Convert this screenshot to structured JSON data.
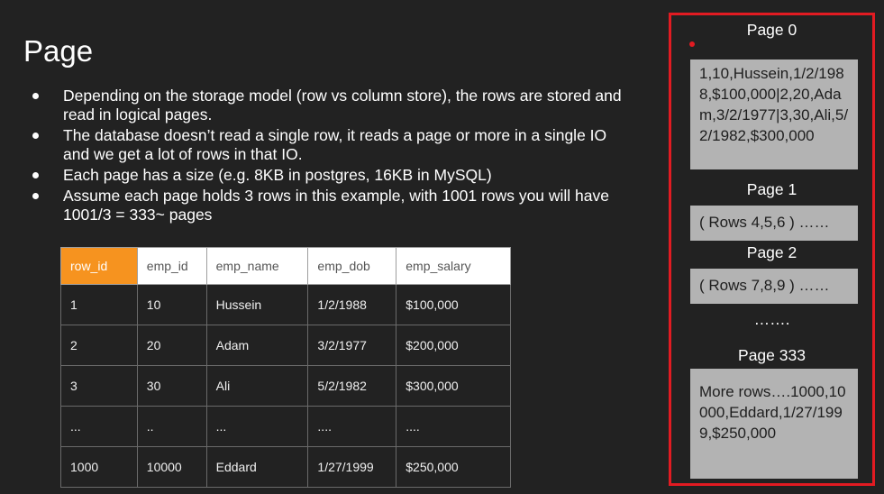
{
  "slide": {
    "title": "Page",
    "bullets": [
      "Depending on the storage model (row vs column store), the rows are stored and read in logical pages.",
      "The database doesn’t read a single row, it reads a page or more in a single IO and we get a lot of rows in that IO.",
      "Each page has a size (e.g. 8KB in postgres, 16KB in MySQL)",
      "Assume each page holds 3 rows in this example, with 1001 rows you will have 1001/3 = 333~ pages"
    ]
  },
  "table": {
    "headers": [
      "row_id",
      "emp_id",
      "emp_name",
      "emp_dob",
      "emp_salary"
    ],
    "rows": [
      [
        "1",
        "10",
        "Hussein",
        "1/2/1988",
        "$100,000"
      ],
      [
        "2",
        "20",
        "Adam",
        "3/2/1977",
        "$200,000"
      ],
      [
        "3",
        "30",
        "Ali",
        "5/2/1982",
        "$300,000"
      ],
      [
        "...",
        "..",
        "...",
        "....",
        "...."
      ],
      [
        "1000",
        "10000",
        "Eddard",
        "1/27/1999",
        "$250,000"
      ]
    ]
  },
  "pages": {
    "page0_label": "Page 0",
    "page0_content": "1,10,Hussein,1/2/1988,$100,000|2,20,Adam,3/2/1977|3,30,Ali,5/2/1982,$300,000",
    "page1_label": "Page 1",
    "page1_content": "( Rows 4,5,6 ) ……",
    "page2_label": "Page 2",
    "page2_content": "( Rows 7,8,9 ) ……",
    "ellipsis": "…….",
    "page333_label": "Page 333",
    "page333_content": "More rows….1000,10000,Eddard,1/27/1999,$250,000"
  },
  "colors": {
    "accent_orange": "#f6931f",
    "panel_border_red": "#e21b22",
    "page_box_gray": "#b3b3b3",
    "background": "#222222"
  }
}
